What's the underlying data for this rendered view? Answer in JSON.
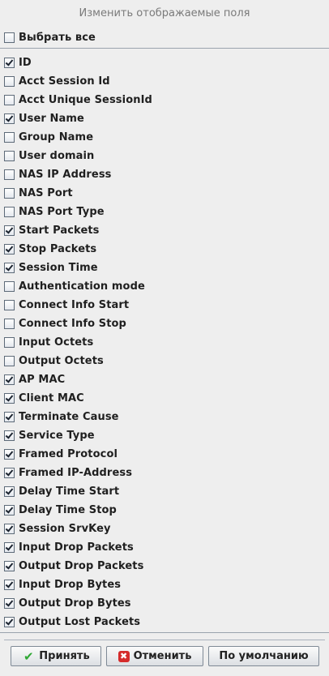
{
  "dialog": {
    "title": "Изменить отображаемые поля",
    "select_all": {
      "label": "Выбрать все",
      "checked": false
    }
  },
  "fields": [
    {
      "label": "ID",
      "checked": true
    },
    {
      "label": "Acct Session Id",
      "checked": false
    },
    {
      "label": "Acct Unique SessionId",
      "checked": false
    },
    {
      "label": "User Name",
      "checked": true
    },
    {
      "label": "Group Name",
      "checked": false
    },
    {
      "label": "User domain",
      "checked": false
    },
    {
      "label": "NAS IP Address",
      "checked": false
    },
    {
      "label": "NAS Port",
      "checked": false
    },
    {
      "label": "NAS Port Type",
      "checked": false
    },
    {
      "label": "Start Packets",
      "checked": true
    },
    {
      "label": "Stop Packets",
      "checked": true
    },
    {
      "label": "Session Time",
      "checked": true
    },
    {
      "label": "Authentication mode",
      "checked": false
    },
    {
      "label": "Connect Info Start",
      "checked": false
    },
    {
      "label": "Connect Info Stop",
      "checked": false
    },
    {
      "label": "Input Octets",
      "checked": false
    },
    {
      "label": "Output Octets",
      "checked": false
    },
    {
      "label": "AP MAC",
      "checked": true
    },
    {
      "label": "Client MAC",
      "checked": true
    },
    {
      "label": "Terminate Cause",
      "checked": true
    },
    {
      "label": "Service Type",
      "checked": true
    },
    {
      "label": "Framed Protocol",
      "checked": true
    },
    {
      "label": "Framed IP-Address",
      "checked": true
    },
    {
      "label": "Delay Time Start",
      "checked": true
    },
    {
      "label": "Delay Time Stop",
      "checked": true
    },
    {
      "label": "Session SrvKey",
      "checked": true
    },
    {
      "label": "Input Drop Packets",
      "checked": true
    },
    {
      "label": "Output Drop Packets",
      "checked": true
    },
    {
      "label": "Input Drop Bytes",
      "checked": true
    },
    {
      "label": "Output Drop Bytes",
      "checked": true
    },
    {
      "label": "Output Lost Packets",
      "checked": true
    }
  ],
  "buttons": {
    "accept": {
      "label": "Принять",
      "icon": "checkmark-icon"
    },
    "cancel": {
      "label": "Отменить",
      "icon": "cross-icon"
    },
    "default": {
      "label": "По умолчанию"
    }
  },
  "colors": {
    "accept_icon": "#2fa834",
    "cancel_icon": "#d52b2b"
  }
}
